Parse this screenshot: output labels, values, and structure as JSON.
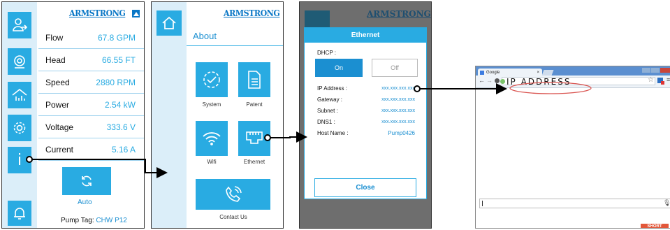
{
  "brand": "ARMSTRONG",
  "screen1": {
    "rows": [
      {
        "label": "Flow",
        "value": "67.8 GPM"
      },
      {
        "label": "Head",
        "value": "66.55 FT"
      },
      {
        "label": "Speed",
        "value": "2880 RPM"
      },
      {
        "label": "Power",
        "value": "2.54 kW"
      },
      {
        "label": "Voltage",
        "value": "333.6 V"
      },
      {
        "label": "Current",
        "value": "5.16 A"
      }
    ],
    "mode_label": "Auto",
    "pump_tag_label": "Pump Tag:",
    "pump_tag_value": "CHW P12",
    "info_glyph": "i",
    "sidebar_icons": [
      "user-login-icon",
      "pump-icon",
      "building-icon",
      "settings-gear-icon",
      "info-icon",
      "bell-icon"
    ]
  },
  "screen2": {
    "title": "About",
    "tiles": [
      "System",
      "Patent",
      "Wifi",
      "Ethernet"
    ],
    "contact": "Contact Us"
  },
  "screen3": {
    "title": "Ethernet",
    "dhcp_label": "DHCP :",
    "on_label": "On",
    "off_label": "Off",
    "fields": [
      {
        "label": "IP Address :",
        "value": "xxx.xxx.xxx.xxx"
      },
      {
        "label": "Gateway :",
        "value": "xxx.xxx.xxx.xxx"
      },
      {
        "label": "Subnet :",
        "value": "xxx.xxx.xxx.xxx"
      },
      {
        "label": "DNS1 :",
        "value": "xxx.xxx.xxx.xxx"
      },
      {
        "label": "Host Name :",
        "value": "Pump0426"
      }
    ],
    "close_label": "Close"
  },
  "browser": {
    "tab_title": "Google",
    "address_text": "IP ADDRESS",
    "footer_badge": "SHORT"
  },
  "colors": {
    "accent": "#29abe2",
    "brand": "#0a77c6",
    "sidebar": "#dbeef9",
    "arrow": "#000000",
    "highlight": "#d9534f"
  }
}
